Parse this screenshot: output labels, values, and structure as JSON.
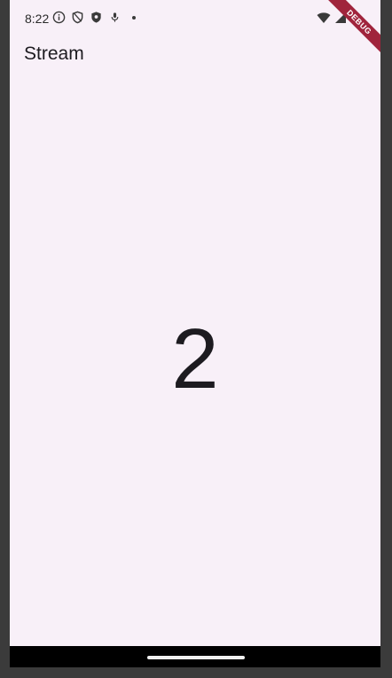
{
  "status_bar": {
    "time": "8:22",
    "icons_left": [
      "info-icon",
      "shield-outline-icon",
      "shield-filled-icon",
      "mic-icon",
      "dot-icon"
    ],
    "icons_right": [
      "wifi-icon",
      "signal-icon"
    ]
  },
  "app_bar": {
    "title": "Stream"
  },
  "main": {
    "counter_value": "2"
  },
  "debug_banner": {
    "label": "DEBUG",
    "color": "#a0243c"
  },
  "colors": {
    "background": "#f8f0f8",
    "text": "#1d1b20",
    "nav_bar": "#000000"
  }
}
